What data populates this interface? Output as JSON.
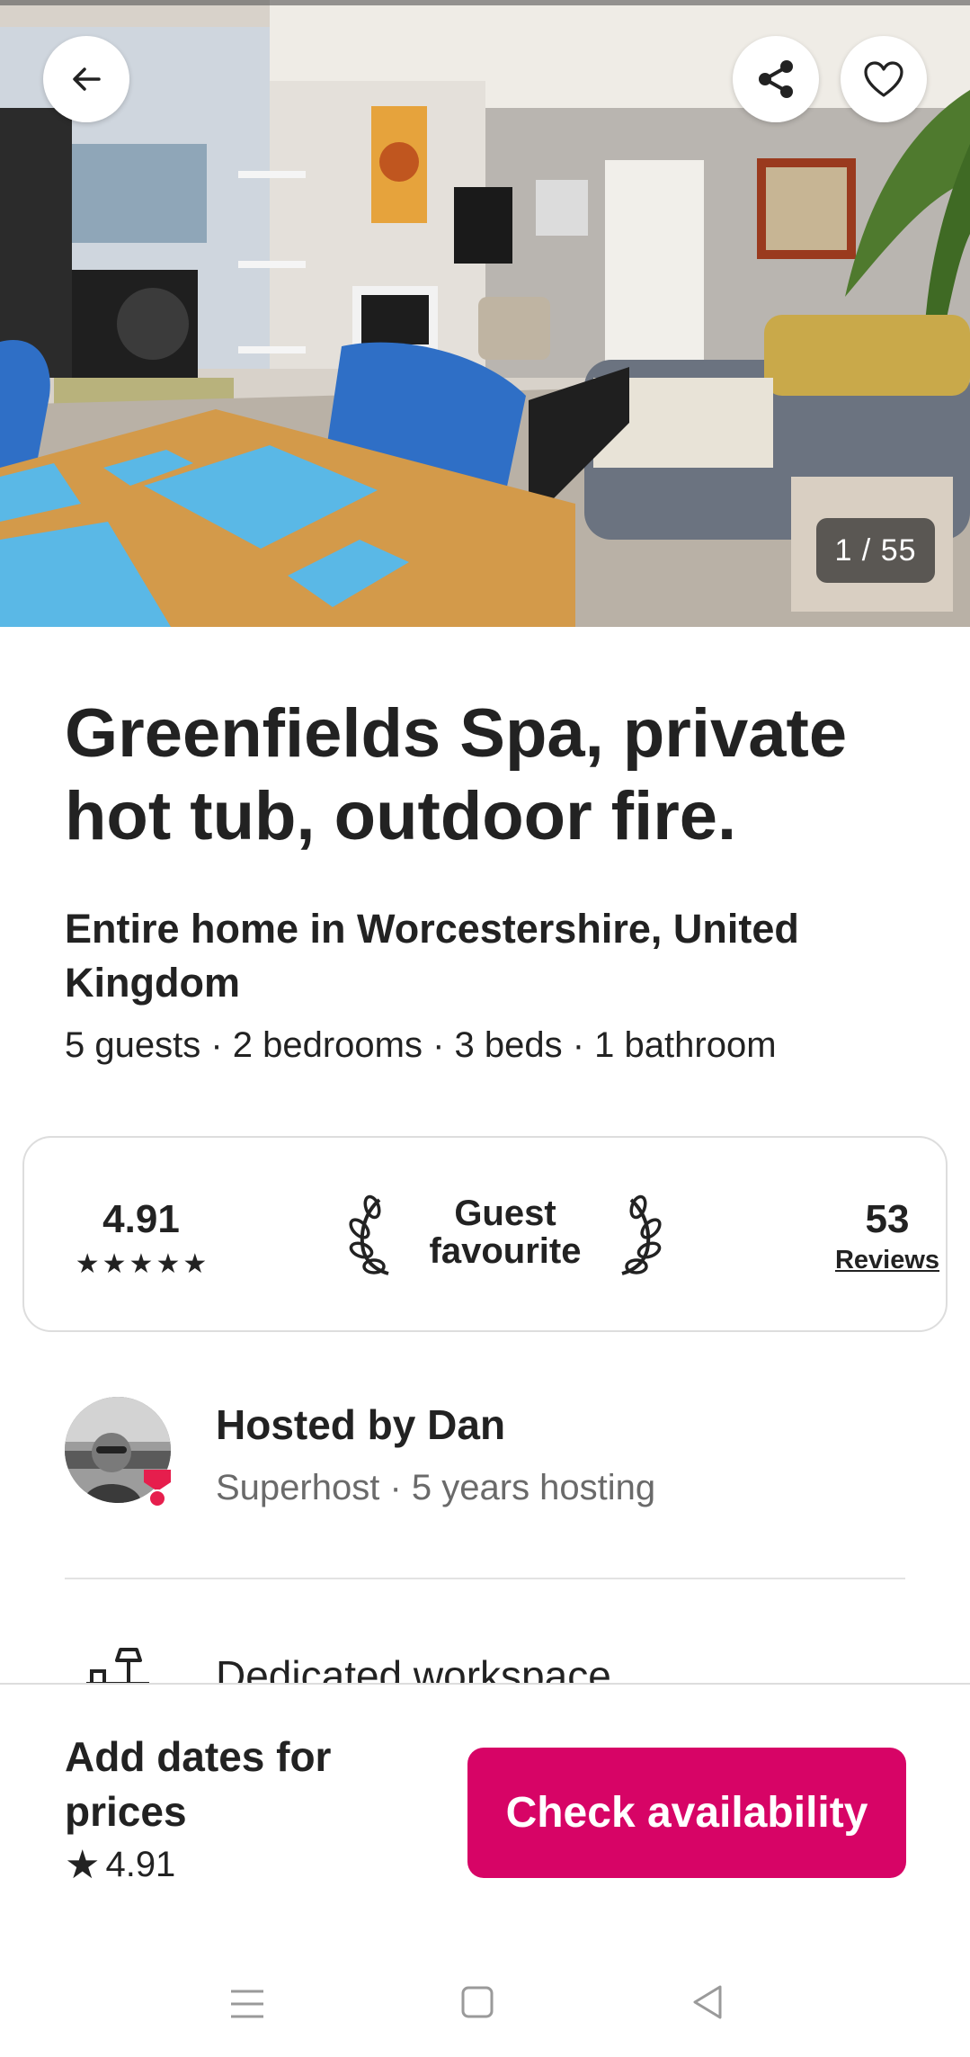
{
  "hero": {
    "photo_counter": "1 / 55",
    "back_icon": "arrow-left-icon",
    "share_icon": "share-icon",
    "favorite_icon": "heart-icon"
  },
  "listing": {
    "title": "Greenfields Spa, private hot tub, outdoor fire.",
    "subtitle": "Entire home in Worcestershire, United Kingdom",
    "details": "5 guests · 2 bedrooms · 3 beds · 1 bathroom"
  },
  "rating_card": {
    "score": "4.91",
    "stars": 5,
    "badge": "Guest favourite",
    "reviews_count": "53",
    "reviews_label": "Reviews"
  },
  "host": {
    "name": "Hosted by Dan",
    "meta": "Superhost · 5 years hosting"
  },
  "amenity": {
    "label": "Dedicated workspace",
    "icon": "desk-lamp-icon"
  },
  "booking_bar": {
    "price_prompt": "Add dates for prices",
    "rating": "4.91",
    "button_label": "Check availability"
  },
  "colors": {
    "brand": "#d70466",
    "text": "#222222",
    "muted": "#6a6a6a",
    "superhost": "#e61e4d"
  }
}
